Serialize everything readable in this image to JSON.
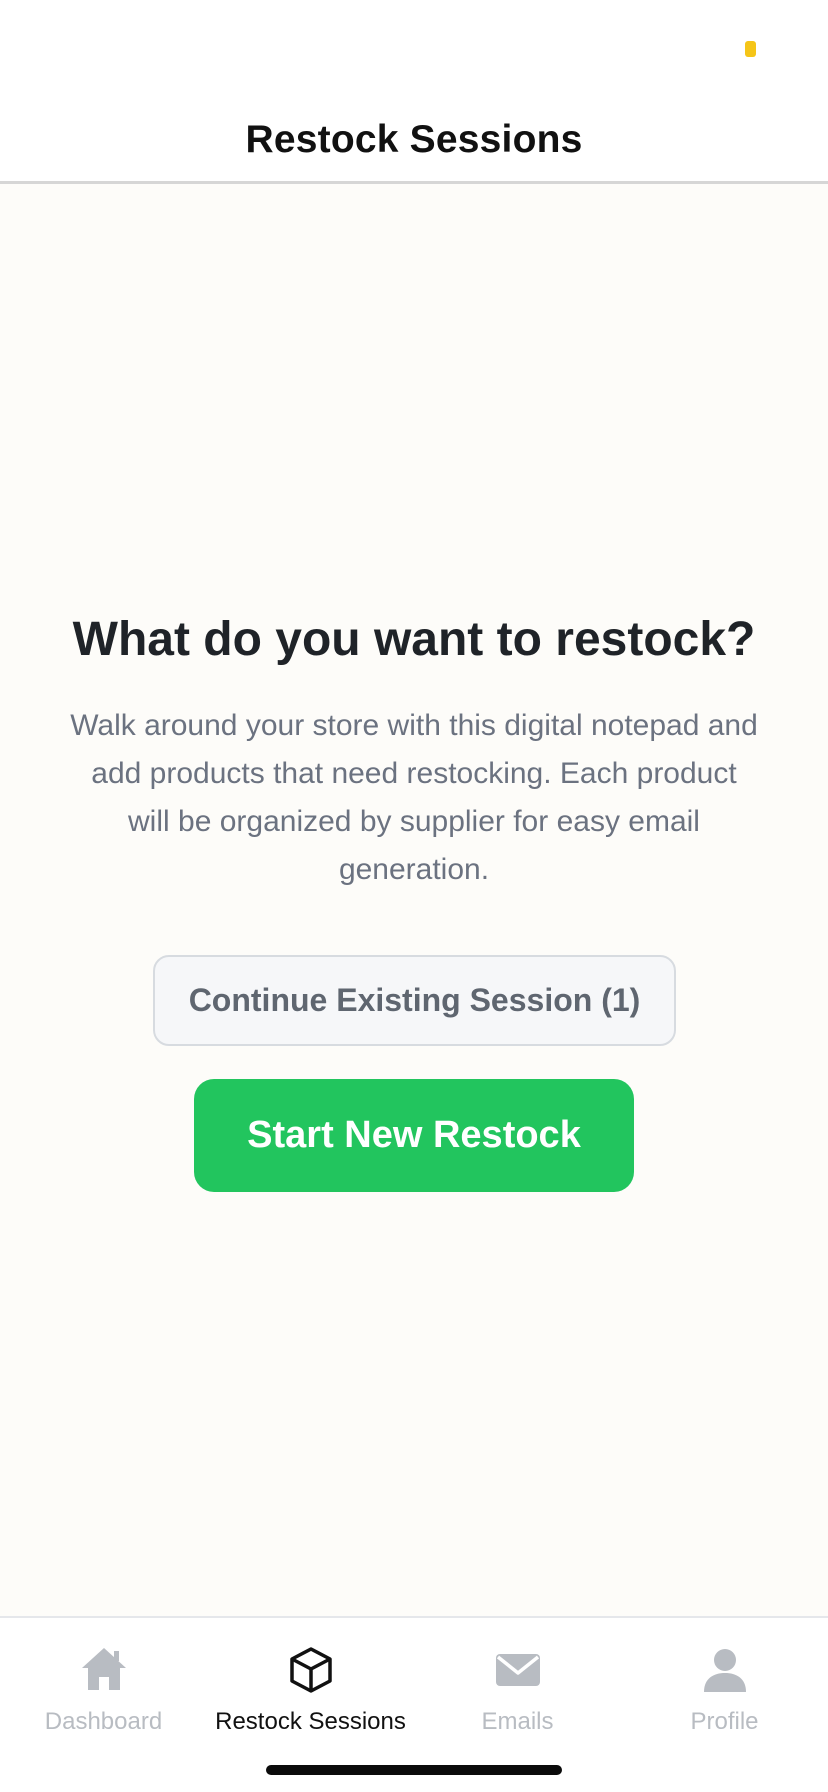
{
  "header": {
    "title": "Restock Sessions"
  },
  "main": {
    "headline": "What do you want to restock?",
    "description": "Walk around your store with this digital notepad and add products that need restocking. Each product will be organized by supplier for easy email generation.",
    "continue_label": "Continue Existing Session (1)",
    "start_label": "Start New Restock"
  },
  "tabs": [
    {
      "label": "Dashboard",
      "icon": "home-icon",
      "active": false
    },
    {
      "label": "Restock Sessions",
      "icon": "box-icon",
      "active": true
    },
    {
      "label": "Emails",
      "icon": "mail-icon",
      "active": false
    },
    {
      "label": "Profile",
      "icon": "person-icon",
      "active": false
    }
  ],
  "colors": {
    "accent": "#22c55e",
    "status_indicator": "#f5c518",
    "inactive_tab": "#b8bcc2",
    "active_tab": "#111111"
  }
}
